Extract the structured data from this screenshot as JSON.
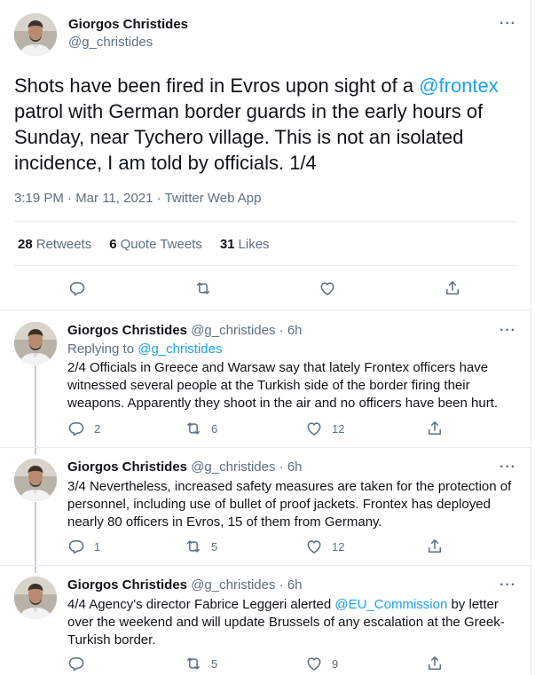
{
  "main_tweet": {
    "author_name": "Giorgos Christides",
    "author_handle": "@g_christides",
    "text_part1": "Shots have been fired in Evros upon sight of a ",
    "mention": "@frontex",
    "text_part2": " patrol with German border guards in the early hours of Sunday, near Tychero village. This is not an isolated incidence, I am told by officials.  1/4",
    "timestamp": "3:19 PM · Mar 11, 2021 · Twitter Web App",
    "retweets_count": "28",
    "retweets_label": "Retweets",
    "quote_count": "6",
    "quote_label": "Quote Tweets",
    "likes_count": "31",
    "likes_label": "Likes"
  },
  "replies": [
    {
      "name": "Giorgos Christides",
      "handle": "@g_christides",
      "time": "· 6h",
      "replying_prefix": "Replying to ",
      "replying_to": "@g_christides",
      "text": "2/4 Officials in Greece and Warsaw say that lately Frontex officers have witnessed several people at the Turkish side of the border firing their weapons. Apparently they shoot in the air and no officers have been hurt.",
      "reply_count": "2",
      "retweet_count": "6",
      "like_count": "12"
    },
    {
      "name": "Giorgos Christides",
      "handle": "@g_christides",
      "time": "· 6h",
      "text": "3/4 Nevertheless, increased safety measures are taken for the protection of personnel, including use of bullet of proof jackets.  Frontex has deployed nearly 80 officers in Evros, 15 of them from Germany.",
      "reply_count": "1",
      "retweet_count": "5",
      "like_count": "12"
    },
    {
      "name": "Giorgos Christides",
      "handle": "@g_christides",
      "time": "· 6h",
      "text_part1": "4/4 Agency's director Fabrice Leggeri alerted ",
      "mention": "@EU_Commission",
      "text_part2": " by letter over the weekend and will update Brussels of any escalation at the Greek-Turkish border.",
      "reply_count": "",
      "retweet_count": "5",
      "like_count": "9"
    }
  ],
  "icons": {
    "more": "more-icon",
    "reply": "reply-icon",
    "retweet": "retweet-icon",
    "like": "heart-icon",
    "share": "share-icon"
  },
  "colors": {
    "accent": "#1da1f2",
    "secondary_text": "#5b7083",
    "divider": "#e6ecf0"
  }
}
